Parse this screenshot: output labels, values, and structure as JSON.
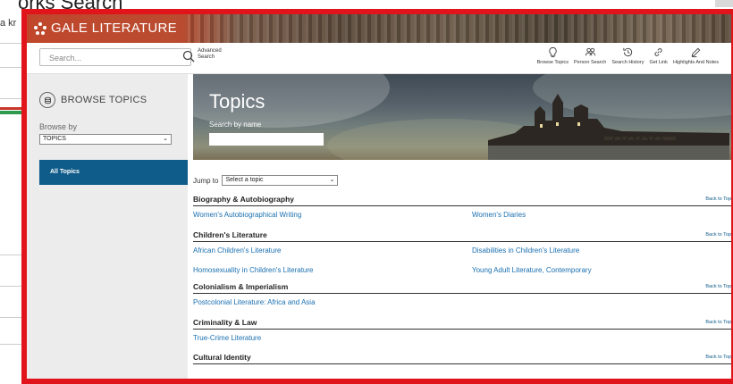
{
  "background_page": {
    "title_fragment": "orks Search",
    "search_fragment": "a kr"
  },
  "brand": {
    "name": "GALE LITERATURE"
  },
  "toolbar": {
    "search_placeholder": "Search...",
    "advanced_search": "Advanced Search",
    "tools": [
      {
        "label": "Browse Topics",
        "icon": "lightbulb-icon"
      },
      {
        "label": "Person Search",
        "icon": "people-icon"
      },
      {
        "label": "Search History",
        "icon": "history-icon"
      },
      {
        "label": "Get Link",
        "icon": "link-icon"
      },
      {
        "label": "Highlights And Notes",
        "icon": "pencil-icon"
      }
    ]
  },
  "sidebar": {
    "heading": "BROWSE TOPICS",
    "browse_by_label": "Browse by",
    "browse_by_value": "TOPICS",
    "all_topics": "All Topics"
  },
  "hero": {
    "title": "Topics",
    "search_label": "Search by name"
  },
  "jump_to": {
    "label": "Jump to",
    "value": "Select a topic"
  },
  "back_to_top": "Back to Top",
  "sections": [
    {
      "title": "Biography & Autobiography",
      "links": [
        "Women's Autobiographical Writing",
        "Women's Diaries"
      ]
    },
    {
      "title": "Children's Literature",
      "links": [
        "African Children's Literature",
        "Disabilities in Children's Literature",
        "Homosexuality in Children's Literature",
        "Young Adult Literature, Contemporary"
      ]
    },
    {
      "title": "Colonialism & Imperialism",
      "links": [
        "Postcolonial Literature: Africa and Asia"
      ]
    },
    {
      "title": "Criminality & Law",
      "links": [
        "True-Crime Literature"
      ]
    },
    {
      "title": "Cultural Identity",
      "links": []
    }
  ]
}
